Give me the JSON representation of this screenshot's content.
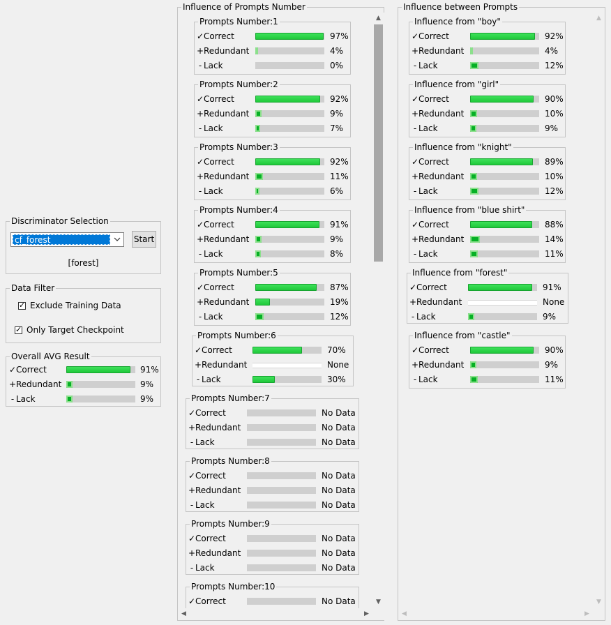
{
  "discriminator": {
    "title": "Discriminator Selection",
    "selected": "cf_forest",
    "start_label": "Start",
    "target_label": "[forest]"
  },
  "data_filter": {
    "title": "Data Filter",
    "exclude_training": {
      "label": "Exclude Training Data",
      "checked": true
    },
    "only_target": {
      "label": "Only Target Checkpoint",
      "checked": true
    }
  },
  "overall": {
    "title": "Overall AVG Result",
    "rows": [
      {
        "mark": "✓",
        "label": "Correct",
        "value": "91%",
        "fill": 91
      },
      {
        "mark": "+",
        "label": "Redundant",
        "value": "9%",
        "fill": 9
      },
      {
        "mark": "-",
        "label": "Lack",
        "value": "9%",
        "fill": 9
      }
    ]
  },
  "prompts_panel": {
    "title": "Influence of Prompts Number",
    "groups": [
      {
        "title": "Prompts Number:1",
        "rows": [
          {
            "mark": "✓",
            "label": "Correct",
            "value": "97%",
            "fill": 97
          },
          {
            "mark": "+",
            "label": "Redundant",
            "value": "4%",
            "fill": 4
          },
          {
            "mark": "-",
            "label": "Lack",
            "value": "0%",
            "fill": 0
          }
        ]
      },
      {
        "title": "Prompts Number:2",
        "rows": [
          {
            "mark": "✓",
            "label": "Correct",
            "value": "92%",
            "fill": 92
          },
          {
            "mark": "+",
            "label": "Redundant",
            "value": "9%",
            "fill": 9
          },
          {
            "mark": "-",
            "label": "Lack",
            "value": "7%",
            "fill": 7
          }
        ]
      },
      {
        "title": "Prompts Number:3",
        "rows": [
          {
            "mark": "✓",
            "label": "Correct",
            "value": "92%",
            "fill": 92
          },
          {
            "mark": "+",
            "label": "Redundant",
            "value": "11%",
            "fill": 11
          },
          {
            "mark": "-",
            "label": "Lack",
            "value": "6%",
            "fill": 6
          }
        ]
      },
      {
        "title": "Prompts Number:4",
        "rows": [
          {
            "mark": "✓",
            "label": "Correct",
            "value": "91%",
            "fill": 91
          },
          {
            "mark": "+",
            "label": "Redundant",
            "value": "9%",
            "fill": 9
          },
          {
            "mark": "-",
            "label": "Lack",
            "value": "8%",
            "fill": 8
          }
        ]
      },
      {
        "title": "Prompts Number:5",
        "rows": [
          {
            "mark": "✓",
            "label": "Correct",
            "value": "87%",
            "fill": 87
          },
          {
            "mark": "+",
            "label": "Redundant",
            "value": "19%",
            "fill": 19
          },
          {
            "mark": "-",
            "label": "Lack",
            "value": "12%",
            "fill": 12
          }
        ]
      },
      {
        "title": "Prompts Number:6",
        "rows": [
          {
            "mark": "✓",
            "label": "Correct",
            "value": "70%",
            "fill": 70
          },
          {
            "mark": "+",
            "label": "Redundant",
            "value": "None",
            "fill": null
          },
          {
            "mark": "-",
            "label": "Lack",
            "value": "30%",
            "fill": 30
          }
        ]
      },
      {
        "title": "Prompts Number:7",
        "rows": [
          {
            "mark": "✓",
            "label": "Correct",
            "value": "No Data",
            "fill": 0
          },
          {
            "mark": "+",
            "label": "Redundant",
            "value": "No Data",
            "fill": 0
          },
          {
            "mark": "-",
            "label": "Lack",
            "value": "No Data",
            "fill": 0
          }
        ]
      },
      {
        "title": "Prompts Number:8",
        "rows": [
          {
            "mark": "✓",
            "label": "Correct",
            "value": "No Data",
            "fill": 0
          },
          {
            "mark": "+",
            "label": "Redundant",
            "value": "No Data",
            "fill": 0
          },
          {
            "mark": "-",
            "label": "Lack",
            "value": "No Data",
            "fill": 0
          }
        ]
      },
      {
        "title": "Prompts Number:9",
        "rows": [
          {
            "mark": "✓",
            "label": "Correct",
            "value": "No Data",
            "fill": 0
          },
          {
            "mark": "+",
            "label": "Redundant",
            "value": "No Data",
            "fill": 0
          },
          {
            "mark": "-",
            "label": "Lack",
            "value": "No Data",
            "fill": 0
          }
        ]
      },
      {
        "title": "Prompts Number:10",
        "rows": [
          {
            "mark": "✓",
            "label": "Correct",
            "value": "No Data",
            "fill": 0
          }
        ]
      }
    ]
  },
  "between_panel": {
    "title": "Influence between Prompts",
    "groups": [
      {
        "title": "Influence from \"boy\"",
        "rows": [
          {
            "mark": "✓",
            "label": "Correct",
            "value": "92%",
            "fill": 92
          },
          {
            "mark": "+",
            "label": "Redundant",
            "value": "4%",
            "fill": 4
          },
          {
            "mark": "-",
            "label": "Lack",
            "value": "12%",
            "fill": 12
          }
        ]
      },
      {
        "title": "Influence from \"girl\"",
        "rows": [
          {
            "mark": "✓",
            "label": "Correct",
            "value": "90%",
            "fill": 90
          },
          {
            "mark": "+",
            "label": "Redundant",
            "value": "10%",
            "fill": 10
          },
          {
            "mark": "-",
            "label": "Lack",
            "value": "9%",
            "fill": 9
          }
        ]
      },
      {
        "title": "Influence from \"knight\"",
        "rows": [
          {
            "mark": "✓",
            "label": "Correct",
            "value": "89%",
            "fill": 89
          },
          {
            "mark": "+",
            "label": "Redundant",
            "value": "10%",
            "fill": 10
          },
          {
            "mark": "-",
            "label": "Lack",
            "value": "12%",
            "fill": 12
          }
        ]
      },
      {
        "title": "Influence from \"blue shirt\"",
        "rows": [
          {
            "mark": "✓",
            "label": "Correct",
            "value": "88%",
            "fill": 88
          },
          {
            "mark": "+",
            "label": "Redundant",
            "value": "14%",
            "fill": 14
          },
          {
            "mark": "-",
            "label": "Lack",
            "value": "11%",
            "fill": 11
          }
        ]
      },
      {
        "title": "Influence from \"forest\"",
        "rows": [
          {
            "mark": "✓",
            "label": "Correct",
            "value": "91%",
            "fill": 91
          },
          {
            "mark": "+",
            "label": "Redundant",
            "value": "None",
            "fill": null
          },
          {
            "mark": "-",
            "label": "Lack",
            "value": "9%",
            "fill": 9
          }
        ]
      },
      {
        "title": "Influence from \"castle\"",
        "rows": [
          {
            "mark": "✓",
            "label": "Correct",
            "value": "90%",
            "fill": 90
          },
          {
            "mark": "+",
            "label": "Redundant",
            "value": "9%",
            "fill": 9
          },
          {
            "mark": "-",
            "label": "Lack",
            "value": "11%",
            "fill": 11
          }
        ]
      }
    ]
  },
  "colors": {
    "accent": "#0078d7",
    "bar_fill": "#06b025",
    "bar_track": "#cfcfcf"
  },
  "icons": {
    "scroll_up": "▲",
    "scroll_down": "▼",
    "scroll_left": "◀",
    "scroll_right": "▶",
    "dropdown": "chevron-down-icon"
  }
}
